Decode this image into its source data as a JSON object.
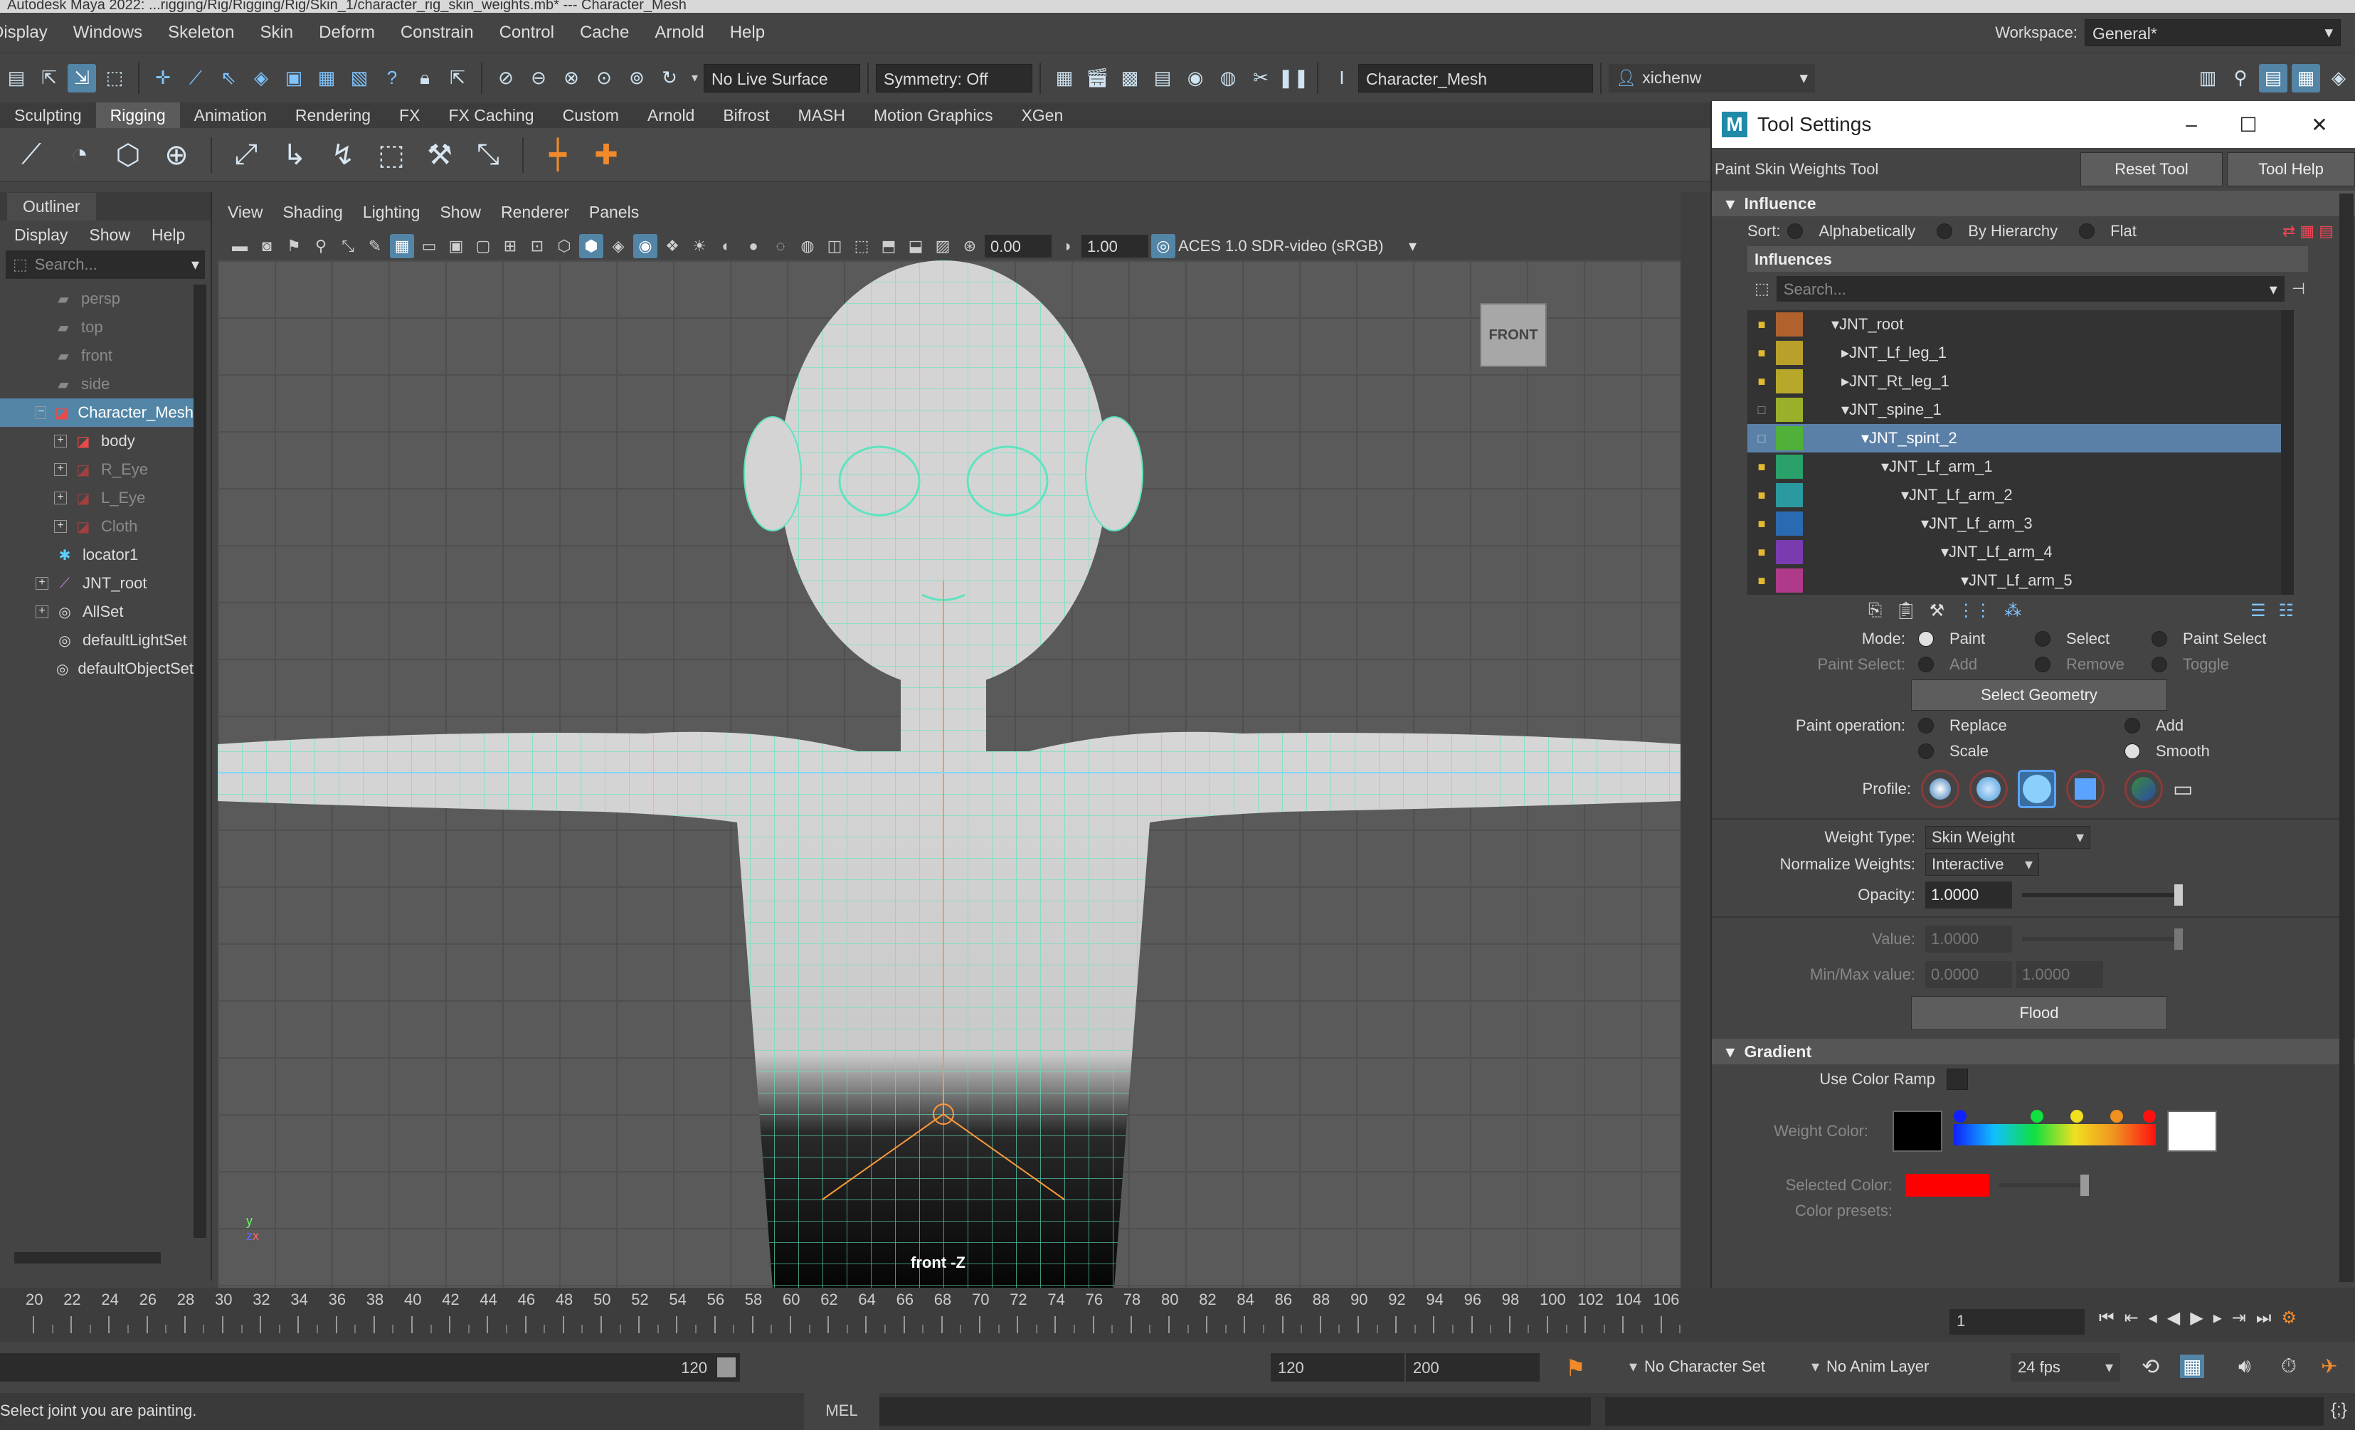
{
  "window": {
    "title": "Autodesk Maya 2022: ...rigging/Rig/Rigging/Rig/Skin_1/character_rig_skin_weights.mb* --- Character_Mesh"
  },
  "main_menu": [
    "Display",
    "Windows",
    "Skeleton",
    "Skin",
    "Deform",
    "Constrain",
    "Control",
    "Cache",
    "Arnold",
    "Help"
  ],
  "workspace": {
    "label": "Workspace:",
    "value": "General*"
  },
  "status_line": {
    "live_surface": "No Live Surface",
    "symmetry": "Symmetry: Off",
    "object_field": "Character_Mesh",
    "user": "xichenw"
  },
  "shelf_tabs": [
    "Sculpting",
    "Rigging",
    "Animation",
    "Rendering",
    "FX",
    "FX Caching",
    "Custom",
    "Arnold",
    "Bifrost",
    "MASH",
    "Motion Graphics",
    "XGen"
  ],
  "shelf_active": "Rigging",
  "outliner": {
    "title": "Outliner",
    "menu": [
      "Display",
      "Show",
      "Help"
    ],
    "search_placeholder": "Search...",
    "items": [
      {
        "label": "persp",
        "dim": true,
        "icon": "camera-icon"
      },
      {
        "label": "top",
        "dim": true,
        "icon": "camera-icon"
      },
      {
        "label": "front",
        "dim": true,
        "icon": "camera-icon"
      },
      {
        "label": "side",
        "dim": true,
        "icon": "camera-icon"
      },
      {
        "label": "Character_Mesh",
        "selected": true,
        "icon": "mesh-group-icon"
      },
      {
        "label": "body",
        "icon": "mesh-icon"
      },
      {
        "label": "R_Eye",
        "dim": true,
        "icon": "mesh-icon"
      },
      {
        "label": "L_Eye",
        "dim": true,
        "icon": "mesh-icon"
      },
      {
        "label": "Cloth",
        "dim": true,
        "icon": "mesh-icon"
      },
      {
        "label": "locator1",
        "icon": "locator-icon"
      },
      {
        "label": "JNT_root",
        "icon": "joint-icon"
      },
      {
        "label": "AllSet",
        "icon": "set-icon"
      },
      {
        "label": "defaultLightSet",
        "icon": "set-icon"
      },
      {
        "label": "defaultObjectSet",
        "icon": "set-icon"
      }
    ]
  },
  "viewport": {
    "menu": [
      "View",
      "Shading",
      "Lighting",
      "Show",
      "Renderer",
      "Panels"
    ],
    "exposure": "0.00",
    "gamma": "1.00",
    "color_space": "ACES 1.0 SDR-video (sRGB)",
    "view_cube": "FRONT",
    "camera_label": "front -Z"
  },
  "tool_settings": {
    "window_title": "Tool Settings",
    "tool_name": "Paint Skin Weights Tool",
    "reset_button": "Reset Tool",
    "help_button": "Tool Help",
    "influence_section": "Influence",
    "sort_label": "Sort:",
    "sort_options": [
      "Alphabetically",
      "By Hierarchy",
      "Flat"
    ],
    "sort_selected": "By Hierarchy",
    "influences_label": "Influences",
    "search_placeholder": "Search...",
    "influences": [
      {
        "name": "JNT_root",
        "color": "#b0622e"
      },
      {
        "name": "JNT_Lf_leg_1",
        "color": "#b8a02a"
      },
      {
        "name": "JNT_Rt_leg_1",
        "color": "#b8a82a"
      },
      {
        "name": "JNT_spine_1",
        "color": "#9ab02a"
      },
      {
        "name": "JNT_spint_2",
        "color": "#4fb03a",
        "selected": true
      },
      {
        "name": "JNT_Lf_arm_1",
        "color": "#2aa06a"
      },
      {
        "name": "JNT_Lf_arm_2",
        "color": "#2a9aa0"
      },
      {
        "name": "JNT_Lf_arm_3",
        "color": "#2a6ab0"
      },
      {
        "name": "JNT_Lf_arm_4",
        "color": "#7a3ab0"
      },
      {
        "name": "JNT_Lf_arm_5",
        "color": "#b03a8a"
      }
    ],
    "mode_label": "Mode:",
    "mode_options": [
      "Paint",
      "Select",
      "Paint Select"
    ],
    "mode_selected": "Paint",
    "paint_select_label": "Paint Select:",
    "paint_select_options": [
      "Add",
      "Remove",
      "Toggle"
    ],
    "select_geometry_button": "Select Geometry",
    "paint_operation_label": "Paint operation:",
    "paint_operations": [
      "Replace",
      "Add",
      "Scale",
      "Smooth"
    ],
    "paint_operation_selected": "Smooth",
    "profile_label": "Profile:",
    "weight_type_label": "Weight Type:",
    "weight_type_value": "Skin Weight",
    "normalize_label": "Normalize Weights:",
    "normalize_value": "Interactive",
    "opacity_label": "Opacity:",
    "opacity_value": "1.0000",
    "opacity_level": 1.0,
    "value_label": "Value:",
    "value_value": "1.0000",
    "minmax_label": "Min/Max value:",
    "min_value": "0.0000",
    "max_value": "1.0000",
    "flood_button": "Flood",
    "gradient_section": "Gradient",
    "use_color_ramp_label": "Use Color Ramp",
    "weight_color_label": "Weight Color:",
    "selected_color_label": "Selected Color:",
    "selected_color": "#ff0000",
    "color_presets_label": "Color presets:"
  },
  "timeline": {
    "ticks": [
      "20",
      "22",
      "24",
      "26",
      "28",
      "30",
      "32",
      "34",
      "36",
      "38",
      "40",
      "42",
      "44",
      "46",
      "48",
      "50",
      "52",
      "54",
      "56",
      "58",
      "60",
      "62",
      "64",
      "66",
      "68",
      "70",
      "72",
      "74",
      "76",
      "78",
      "80",
      "82",
      "84",
      "86",
      "88",
      "90",
      "92",
      "94",
      "96",
      "98",
      "100",
      "102",
      "104",
      "106"
    ],
    "current_frame": "1"
  },
  "range": {
    "range_end": "120",
    "anim_end": "120",
    "anim_max": "200",
    "character_set": "No Character Set",
    "anim_layer": "No Anim Layer",
    "fps": "24 fps"
  },
  "command_line": {
    "help": "Select joint you are painting.",
    "language": "MEL"
  }
}
